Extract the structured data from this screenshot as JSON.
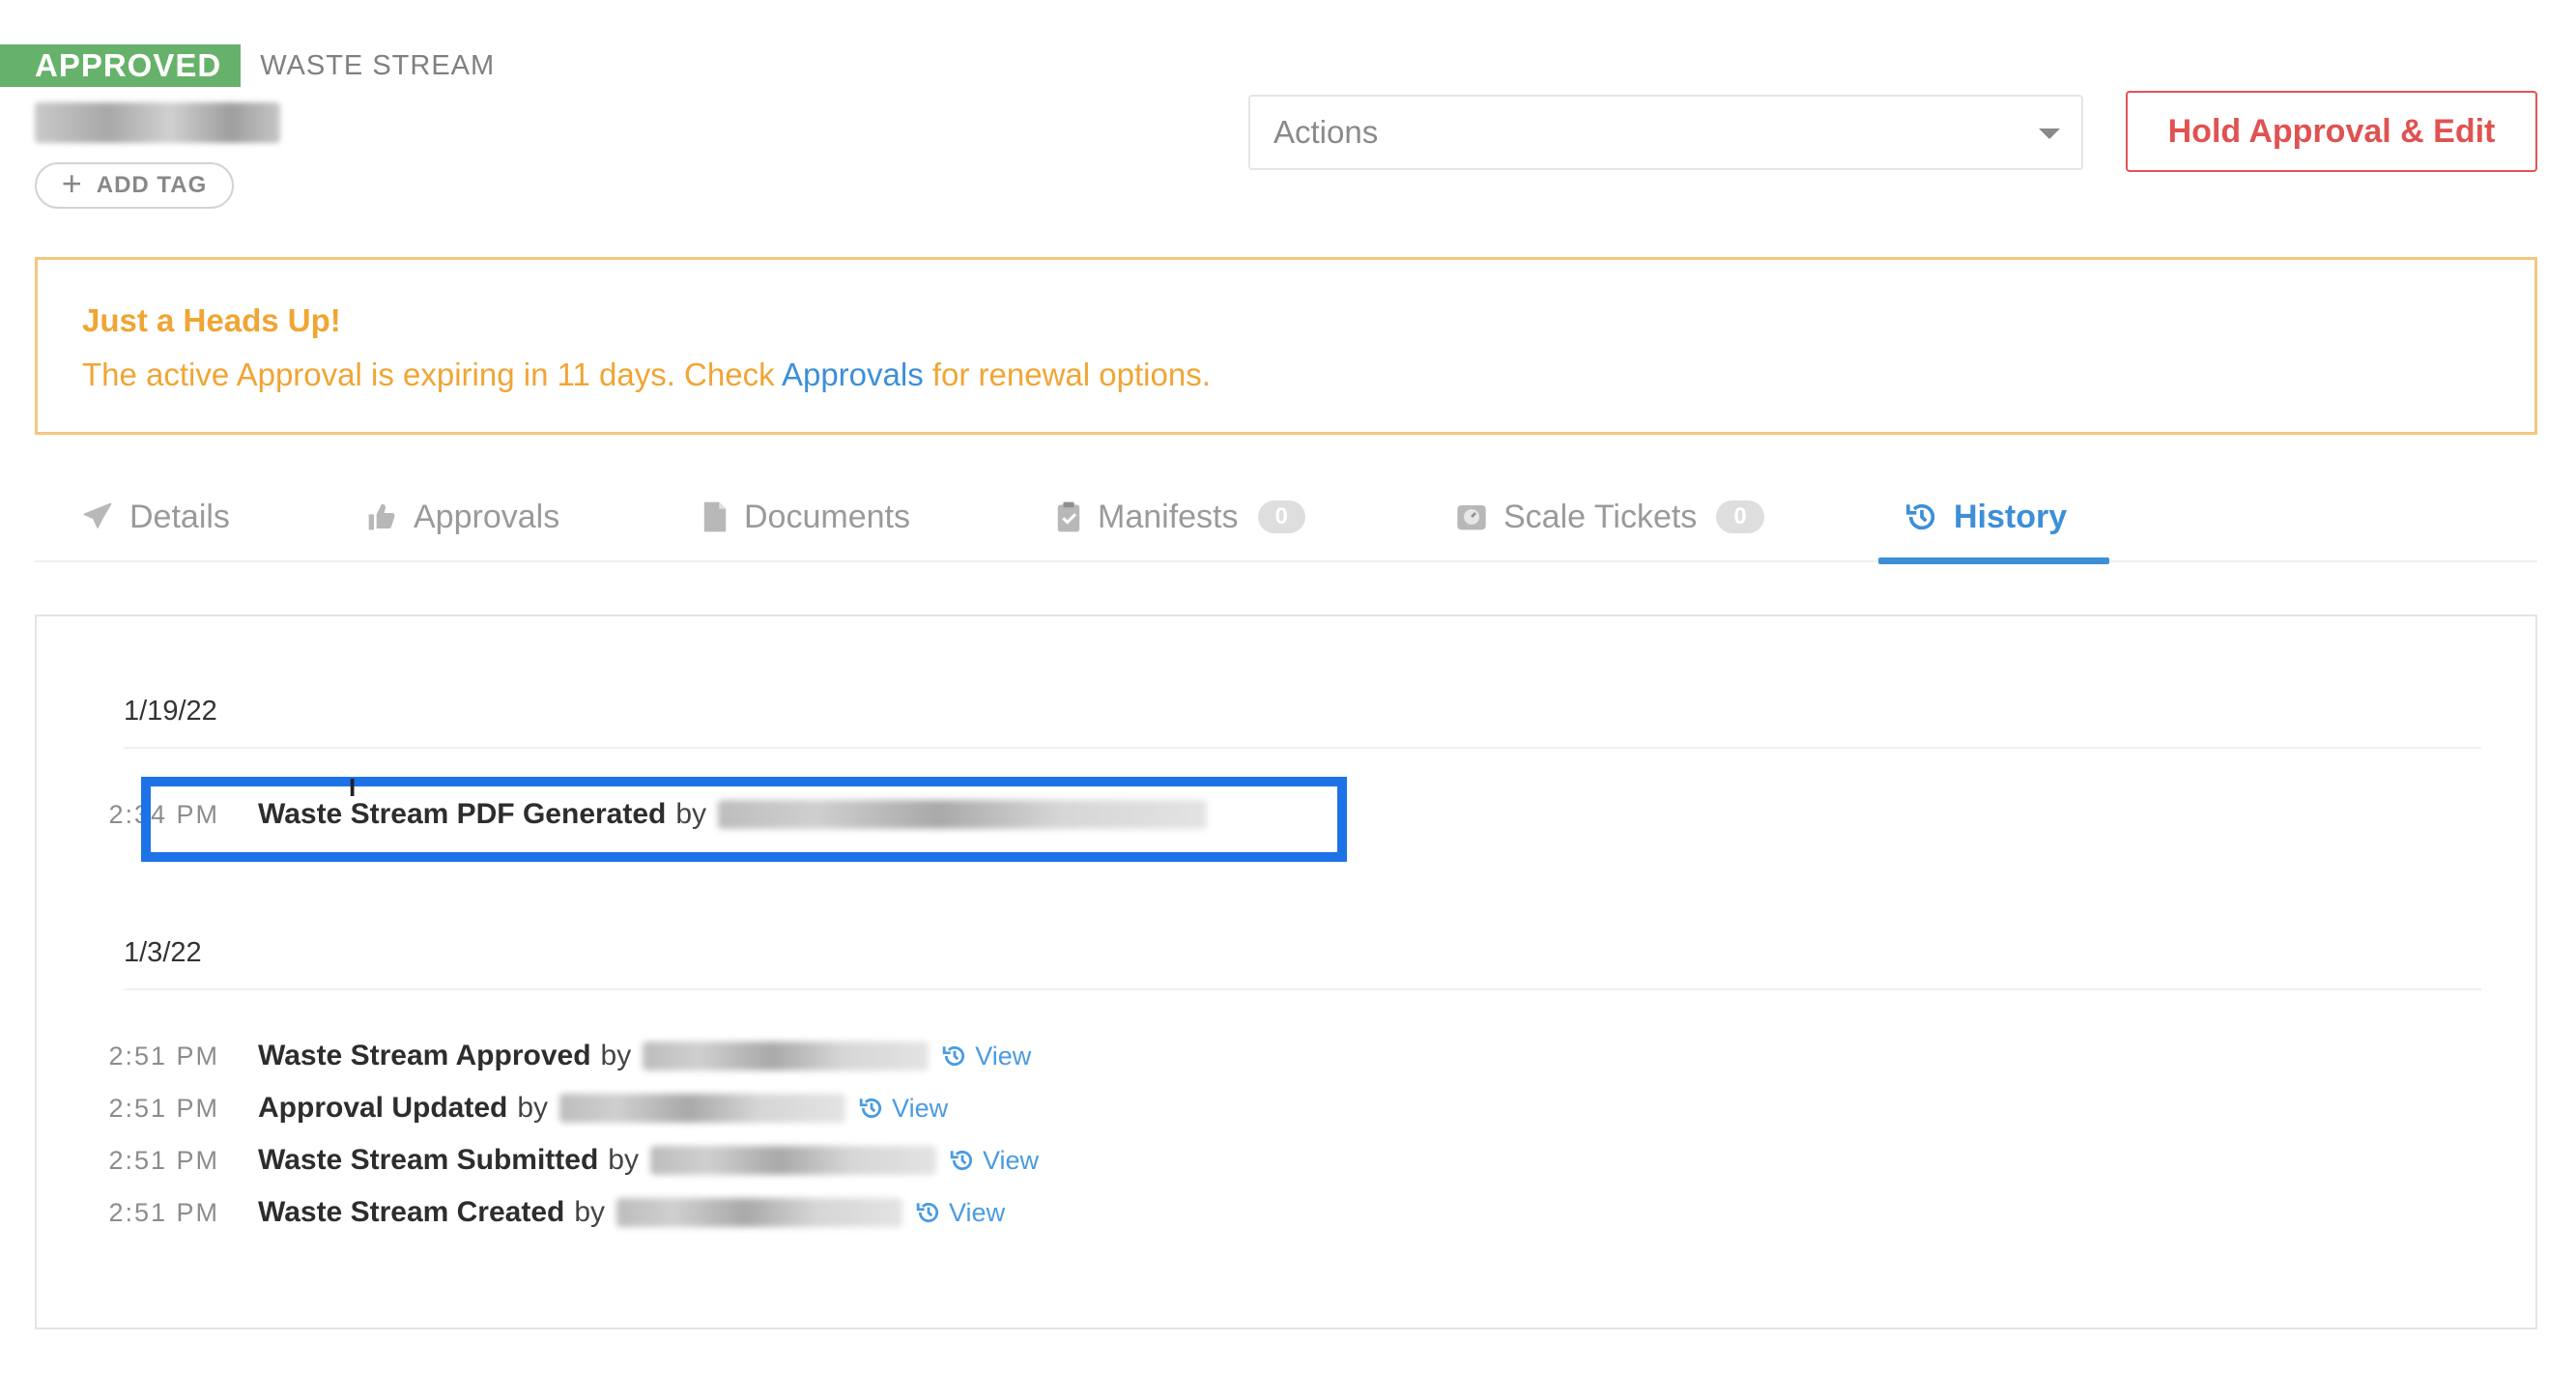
{
  "header": {
    "status": "APPROVED",
    "stream_label": "WASTE STREAM",
    "add_tag_label": "ADD TAG",
    "actions_label": "Actions",
    "hold_button_label": "Hold Approval & Edit"
  },
  "alert": {
    "title": "Just a Heads Up!",
    "body_prefix": "The active Approval is expiring in 11 days. Check",
    "link_text": "Approvals",
    "body_suffix": "for renewal options."
  },
  "tabs": [
    {
      "label": "Details",
      "icon": "paper-plane-icon"
    },
    {
      "label": "Approvals",
      "icon": "thumbs-up-icon"
    },
    {
      "label": "Documents",
      "icon": "document-icon"
    },
    {
      "label": "Manifests",
      "icon": "clipboard-check-icon",
      "count": "0"
    },
    {
      "label": "Scale Tickets",
      "icon": "scale-icon",
      "count": "0"
    },
    {
      "label": "History",
      "icon": "history-icon",
      "active": true
    }
  ],
  "history": {
    "groups": [
      {
        "date": "1/19/22",
        "entries": [
          {
            "time": "2:34 PM",
            "event": "Waste Stream PDF Generated",
            "by": "by"
          }
        ]
      },
      {
        "date": "1/3/22",
        "entries": [
          {
            "time": "2:51 PM",
            "event": "Waste Stream Approved",
            "by": "by",
            "view": "View"
          },
          {
            "time": "2:51 PM",
            "event": "Approval Updated",
            "by": "by",
            "view": "View"
          },
          {
            "time": "2:51 PM",
            "event": "Waste Stream Submitted",
            "by": "by",
            "view": "View"
          },
          {
            "time": "2:51 PM",
            "event": "Waste Stream Created",
            "by": "by",
            "view": "View"
          }
        ]
      }
    ]
  },
  "colors": {
    "approved_green": "#67b26a",
    "hold_red": "#e05252",
    "alert_orange": "#f0a534",
    "link_blue": "#3d8fd8",
    "highlight_blue": "#1d72e8"
  }
}
